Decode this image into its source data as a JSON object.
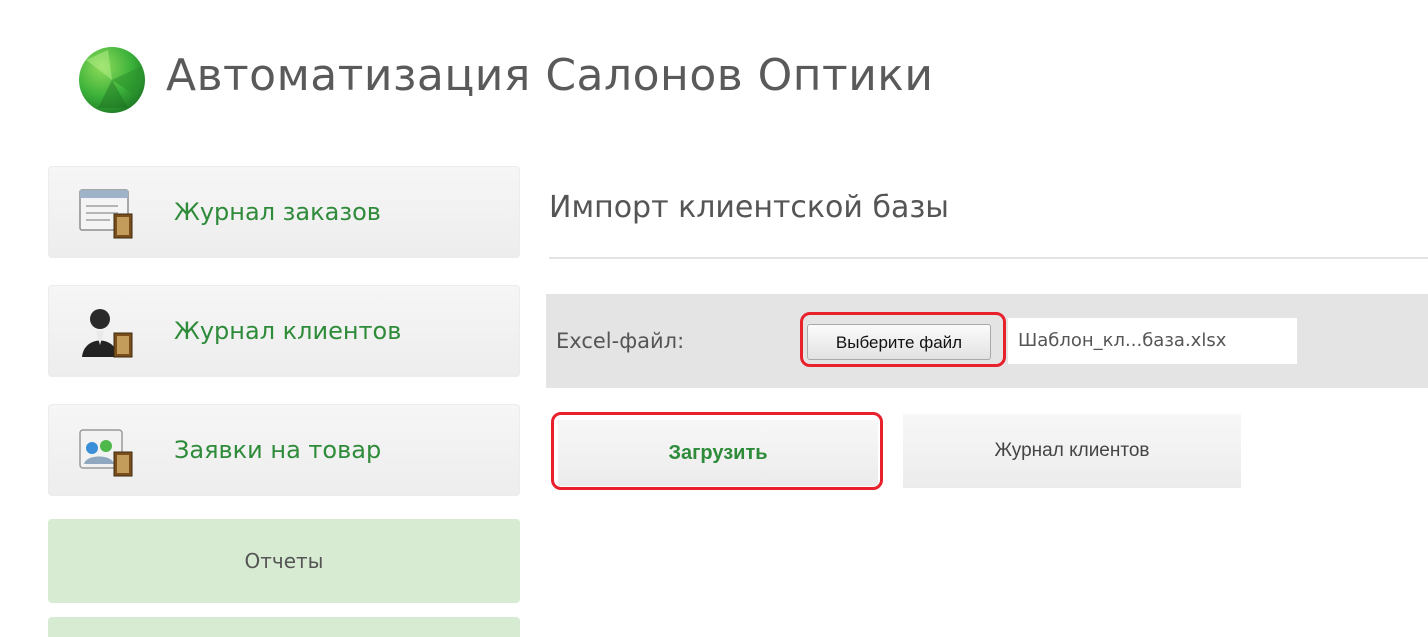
{
  "app": {
    "title": "Автоматизация Салонов Оптики"
  },
  "sidebar": {
    "items": [
      {
        "label": "Журнал заказов",
        "icon": "orders-icon"
      },
      {
        "label": "Журнал клиентов",
        "icon": "clients-icon"
      },
      {
        "label": "Заявки на товар",
        "icon": "requests-icon"
      },
      {
        "label": "Отчеты"
      },
      {
        "label": ""
      }
    ]
  },
  "main": {
    "page_title": "Импорт клиентской базы",
    "form": {
      "file_label": "Excel-файл:",
      "choose_button": "Выберите файл",
      "file_name": "Шаблон_кл...база.xlsx"
    },
    "actions": {
      "upload": "Загрузить",
      "clients_journal": "Журнал клиентов"
    }
  },
  "colors": {
    "accent_green": "#2e8b3a",
    "highlight_red": "#e8212c",
    "report_bg": "#d6ebd2"
  }
}
